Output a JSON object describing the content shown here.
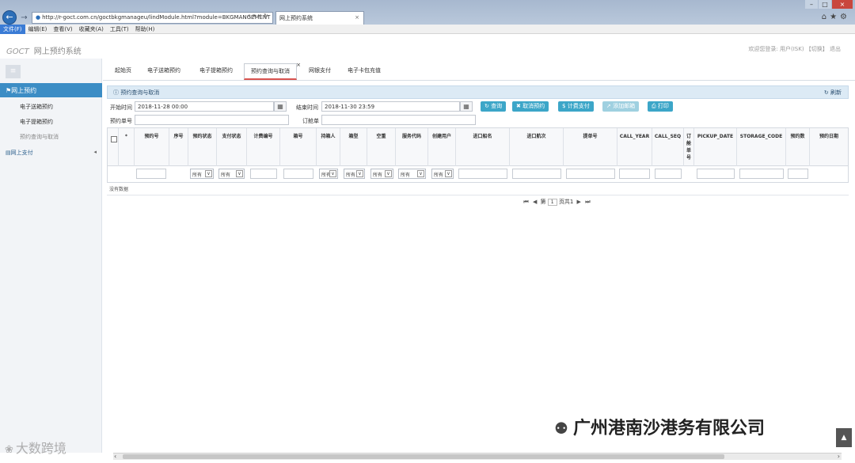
{
  "browser": {
    "url": "http://r-goct.com.cn/goctbkgmanageu/lindModule.html?module=BKGMANGEMENT",
    "url_tools": "⌕ ▾ × ↻",
    "tab_title": "网上预约系统",
    "tab_close": "×",
    "back_icon": "←",
    "forward_icon": "→",
    "right_icons": "⌂★⚙",
    "window_controls": {
      "min": "–",
      "max": "□",
      "close": "×"
    }
  },
  "menubar": [
    "文件(F)",
    "编辑(E)",
    "查看(V)",
    "收藏夹(A)",
    "工具(T)",
    "帮助(H)"
  ],
  "header": {
    "logo_text": "网上预约系统",
    "logo_mark": "GOCT",
    "right_text": "欢迎您登录: 用户(ISK)  【切换】    退出"
  },
  "sidebar": {
    "toggle_icon": "≡",
    "primary": "网上预约",
    "primary_icon": "⚑",
    "items": [
      "电子送箱预约",
      "电子提箱预约",
      "预约查询与取消"
    ],
    "section": "网上支付",
    "section_icon": "▤",
    "section_arrow": "◂"
  },
  "tabs": [
    "起始页",
    "电子送箱预约",
    "电子提箱预约",
    "预约查询与取消",
    "网银支付",
    "电子卡包充值"
  ],
  "tab_close": "×",
  "panel": {
    "title": "预约查询与取消",
    "title_icon": "ⓘ",
    "refresh": "刷新",
    "refresh_icon": "↻"
  },
  "form": {
    "start_label": "开始时间",
    "start_value": "2018-11-28 00:00",
    "end_label": "结束时间",
    "end_value": "2018-11-30 23:59",
    "booking_no_label": "预约单号",
    "order_no_label": "订舱单",
    "calendar_icon": "▦"
  },
  "buttons": [
    {
      "icon": "↻",
      "label": "查询"
    },
    {
      "icon": "✖",
      "label": "取消预约"
    },
    {
      "icon": "$",
      "label": "计费支付"
    },
    {
      "icon": "➚",
      "label": "添加邮箱"
    },
    {
      "icon": "⎙",
      "label": "打印"
    }
  ],
  "grid": {
    "checkbox_col": "",
    "star_col": "*",
    "columns": [
      "预约号",
      "序号",
      "预约状态",
      "支付状态",
      "计费编号",
      "箱号",
      "持箱人",
      "箱型",
      "空重",
      "服务代码",
      "创建用户",
      "进口船名",
      "进口航次",
      "提单号",
      "CALL_YEAR",
      "CALL_SEQ",
      "订舱单号",
      "PICKUP_DATE",
      "STORAGE_CODE",
      "预约数",
      "预约日期"
    ],
    "filter_all": "所有",
    "filter_dd": "∨",
    "empty_text": "没有数据"
  },
  "pager": {
    "first": "⏮",
    "prev": "◀",
    "page_prefix": "第",
    "page_value": "1",
    "page_suffix": "页共1",
    "next": "▶",
    "last": "⏭"
  },
  "scroll": {
    "left": "‹",
    "right": "›",
    "top_icon": "▲"
  },
  "watermarks": {
    "left": "大数跨境",
    "left_icon": "❀",
    "right": "广州港南沙港务有限公司",
    "right_icon": "⚉"
  }
}
